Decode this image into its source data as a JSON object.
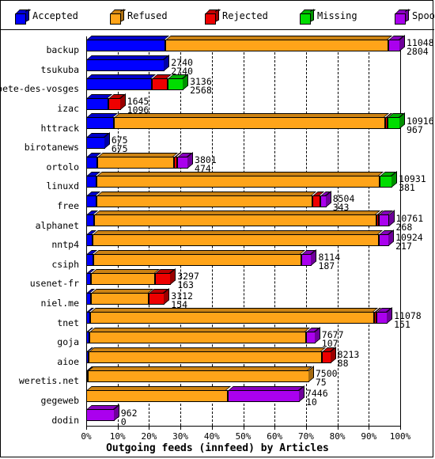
{
  "legend": {
    "items": [
      {
        "label": "Accepted",
        "color": "#0000FF",
        "icon": "cube-icon"
      },
      {
        "label": "Refused",
        "color": "#FFA419",
        "icon": "cube-icon"
      },
      {
        "label": "Rejected",
        "color": "#EE0000",
        "icon": "cube-icon"
      },
      {
        "label": "Missing",
        "color": "#00DD00",
        "icon": "cube-icon"
      },
      {
        "label": "Spooled",
        "color": "#AA00EE",
        "icon": "cube-icon"
      }
    ]
  },
  "chart_data": {
    "type": "bar",
    "orientation": "horizontal",
    "stacked": true,
    "title": "",
    "xlabel": "Outgoing feeds (innfeed) by Articles",
    "ylabel": "",
    "xlim": [
      0,
      100
    ],
    "xticks": [
      "0%",
      "10%",
      "20%",
      "30%",
      "40%",
      "50%",
      "60%",
      "70%",
      "80%",
      "90%",
      "100%"
    ],
    "grid": true,
    "legend_position": "top",
    "series": [
      {
        "name": "Accepted",
        "color": "#0000FF"
      },
      {
        "name": "Refused",
        "color": "#FFA419"
      },
      {
        "name": "Rejected",
        "color": "#EE0000"
      },
      {
        "name": "Missing",
        "color": "#00DD00"
      },
      {
        "name": "Spooled",
        "color": "#AA00EE"
      }
    ],
    "categories": [
      "backup",
      "tsukuba",
      "bete-des-vosges",
      "izac",
      "httrack",
      "birotanews",
      "ortolo",
      "linuxd",
      "free",
      "alphanet",
      "nntp4",
      "csiph",
      "usenet-fr",
      "niel.me",
      "tnet",
      "goja",
      "aioe",
      "weretis.net",
      "gegeweb",
      "dodin"
    ],
    "rows": [
      {
        "label": "backup",
        "value_top": "11048",
        "value_bottom": "2804",
        "pct": {
          "accepted": 25.2,
          "refused": 71.0,
          "rejected": 0.0,
          "missing": 0.0,
          "spooled": 3.8
        }
      },
      {
        "label": "tsukuba",
        "value_top": "2740",
        "value_bottom": "2740",
        "pct": {
          "accepted": 25.0,
          "refused": 0.0,
          "rejected": 0.0,
          "missing": 0.0,
          "spooled": 0.0
        }
      },
      {
        "label": "bete-des-vosges",
        "value_top": "3136",
        "value_bottom": "2568",
        "pct": {
          "accepted": 21.0,
          "refused": 0.0,
          "rejected": 5.0,
          "missing": 5.0,
          "spooled": 0.0
        }
      },
      {
        "label": "izac",
        "value_top": "1645",
        "value_bottom": "1096",
        "pct": {
          "accepted": 7.0,
          "refused": 0.0,
          "rejected": 4.0,
          "missing": 0.0,
          "spooled": 0.0
        }
      },
      {
        "label": "httrack",
        "value_top": "10916",
        "value_bottom": "967",
        "pct": {
          "accepted": 8.9,
          "refused": 86.3,
          "rejected": 0.8,
          "missing": 4.0,
          "spooled": 0.0
        }
      },
      {
        "label": "birotanews",
        "value_top": "675",
        "value_bottom": "675",
        "pct": {
          "accepted": 6.0,
          "refused": 0.0,
          "rejected": 0.0,
          "missing": 0.0,
          "spooled": 0.0
        }
      },
      {
        "label": "ortolo",
        "value_top": "3801",
        "value_bottom": "474",
        "pct": {
          "accepted": 3.5,
          "refused": 24.5,
          "rejected": 1.0,
          "missing": 0.0,
          "spooled": 3.5
        }
      },
      {
        "label": "linuxd",
        "value_top": "10931",
        "value_bottom": "381",
        "pct": {
          "accepted": 3.4,
          "refused": 90.1,
          "rejected": 0.0,
          "missing": 4.0,
          "spooled": 0.0
        }
      },
      {
        "label": "free",
        "value_top": "8504",
        "value_bottom": "343",
        "pct": {
          "accepted": 3.2,
          "refused": 68.8,
          "rejected": 2.5,
          "missing": 0.0,
          "spooled": 2.0
        }
      },
      {
        "label": "alphanet",
        "value_top": "10761",
        "value_bottom": "268",
        "pct": {
          "accepted": 2.4,
          "refused": 90.0,
          "rejected": 0.9,
          "missing": 0.0,
          "spooled": 3.3
        }
      },
      {
        "label": "nntp4",
        "value_top": "10924",
        "value_bottom": "217",
        "pct": {
          "accepted": 1.9,
          "refused": 91.3,
          "rejected": 0.0,
          "missing": 0.0,
          "spooled": 3.3
        }
      },
      {
        "label": "csiph",
        "value_top": "8114",
        "value_bottom": "187",
        "pct": {
          "accepted": 2.2,
          "refused": 66.3,
          "rejected": 0.0,
          "missing": 0.0,
          "spooled": 3.4
        }
      },
      {
        "label": "usenet-fr",
        "value_top": "3297",
        "value_bottom": "163",
        "pct": {
          "accepted": 1.4,
          "refused": 20.6,
          "rejected": 5.0,
          "missing": 0.0,
          "spooled": 0.0
        }
      },
      {
        "label": "niel.me",
        "value_top": "3112",
        "value_bottom": "154",
        "pct": {
          "accepted": 1.4,
          "refused": 18.6,
          "rejected": 5.0,
          "missing": 0.0,
          "spooled": 0.0
        }
      },
      {
        "label": "tnet",
        "value_top": "11078",
        "value_bottom": "151",
        "pct": {
          "accepted": 1.2,
          "refused": 90.5,
          "rejected": 0.7,
          "missing": 0.0,
          "spooled": 3.6
        }
      },
      {
        "label": "goja",
        "value_top": "7677",
        "value_bottom": "107",
        "pct": {
          "accepted": 0.9,
          "refused": 69.1,
          "rejected": 0.0,
          "missing": 0.0,
          "spooled": 3.0
        }
      },
      {
        "label": "aioe",
        "value_top": "8213",
        "value_bottom": "88",
        "pct": {
          "accepted": 0.7,
          "refused": 74.3,
          "rejected": 3.0,
          "missing": 0.0,
          "spooled": 0.0
        }
      },
      {
        "label": "weretis.net",
        "value_top": "7500",
        "value_bottom": "75",
        "pct": {
          "accepted": 0.6,
          "refused": 70.4,
          "rejected": 0.0,
          "missing": 0.0,
          "spooled": 0.0
        }
      },
      {
        "label": "gegeweb",
        "value_top": "7446",
        "value_bottom": "10",
        "pct": {
          "accepted": 0.1,
          "refused": 44.9,
          "rejected": 0.0,
          "missing": 0.0,
          "spooled": 23.0
        }
      },
      {
        "label": "dodin",
        "value_top": "962",
        "value_bottom": "0",
        "pct": {
          "accepted": 0.0,
          "refused": 0.0,
          "rejected": 0.0,
          "missing": 0.0,
          "spooled": 9.0
        }
      }
    ]
  }
}
